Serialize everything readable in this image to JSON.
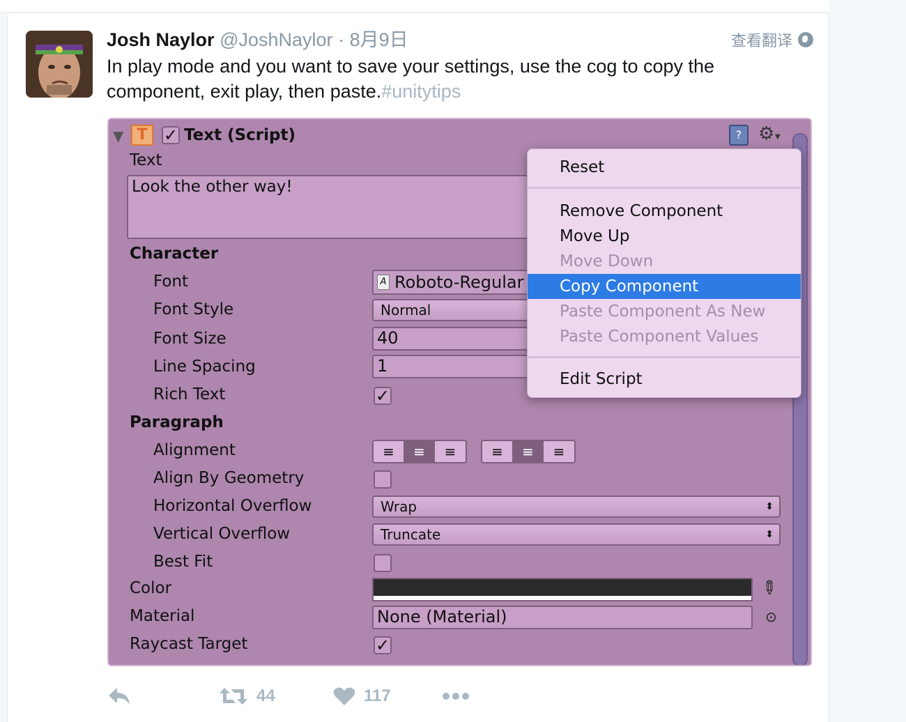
{
  "tweet": {
    "name": "Josh Naylor",
    "handle": "@JoshNaylor",
    "separator": "·",
    "time": "8月9日",
    "translate_label": "查看翻译",
    "text": "In play mode and you want to save your settings, use the cog to copy the component, exit play, then paste.",
    "hashtag": "#unitytips",
    "reply_count": "",
    "retweet_count": "44",
    "like_count": "117"
  },
  "inspector": {
    "component_letter": "T",
    "component_title": "Text (Script)",
    "text_label": "Text",
    "text_value": "Look the other way!",
    "character_header": "Character",
    "font_label": "Font",
    "font_value": "Roboto-Regular",
    "font_icon_glyph": "A",
    "font_style_label": "Font Style",
    "font_style_value": "Normal",
    "font_size_label": "Font Size",
    "font_size_value": "40",
    "line_spacing_label": "Line Spacing",
    "line_spacing_value": "1",
    "rich_text_label": "Rich Text",
    "rich_text_checked": true,
    "paragraph_header": "Paragraph",
    "alignment_label": "Alignment",
    "align_by_geometry_label": "Align By Geometry",
    "horizontal_overflow_label": "Horizontal Overflow",
    "horizontal_overflow_value": "Wrap",
    "vertical_overflow_label": "Vertical Overflow",
    "vertical_overflow_value": "Truncate",
    "best_fit_label": "Best Fit",
    "color_label": "Color",
    "color_value": "#2b2b2b",
    "material_label": "Material",
    "material_value": "None (Material)",
    "raycast_target_label": "Raycast Target",
    "raycast_checked": true
  },
  "context_menu": {
    "items": [
      {
        "label": "Reset",
        "state": "enabled"
      },
      {
        "label": "Remove Component",
        "state": "enabled"
      },
      {
        "label": "Move Up",
        "state": "enabled"
      },
      {
        "label": "Move Down",
        "state": "disabled"
      },
      {
        "label": "Copy Component",
        "state": "selected"
      },
      {
        "label": "Paste Component As New",
        "state": "disabled"
      },
      {
        "label": "Paste Component Values",
        "state": "disabled"
      },
      {
        "label": "Edit Script",
        "state": "enabled"
      }
    ]
  },
  "colors": {
    "link_gray": "#8899a6",
    "menu_highlight": "#2d7be5",
    "inspector_bg": "#ae86ae"
  },
  "icons": [
    "reply-icon",
    "retweet-icon",
    "like-icon",
    "more-icon",
    "globe-icon",
    "gear-icon",
    "help-book-icon",
    "eyedropper-icon",
    "object-picker-icon"
  ]
}
